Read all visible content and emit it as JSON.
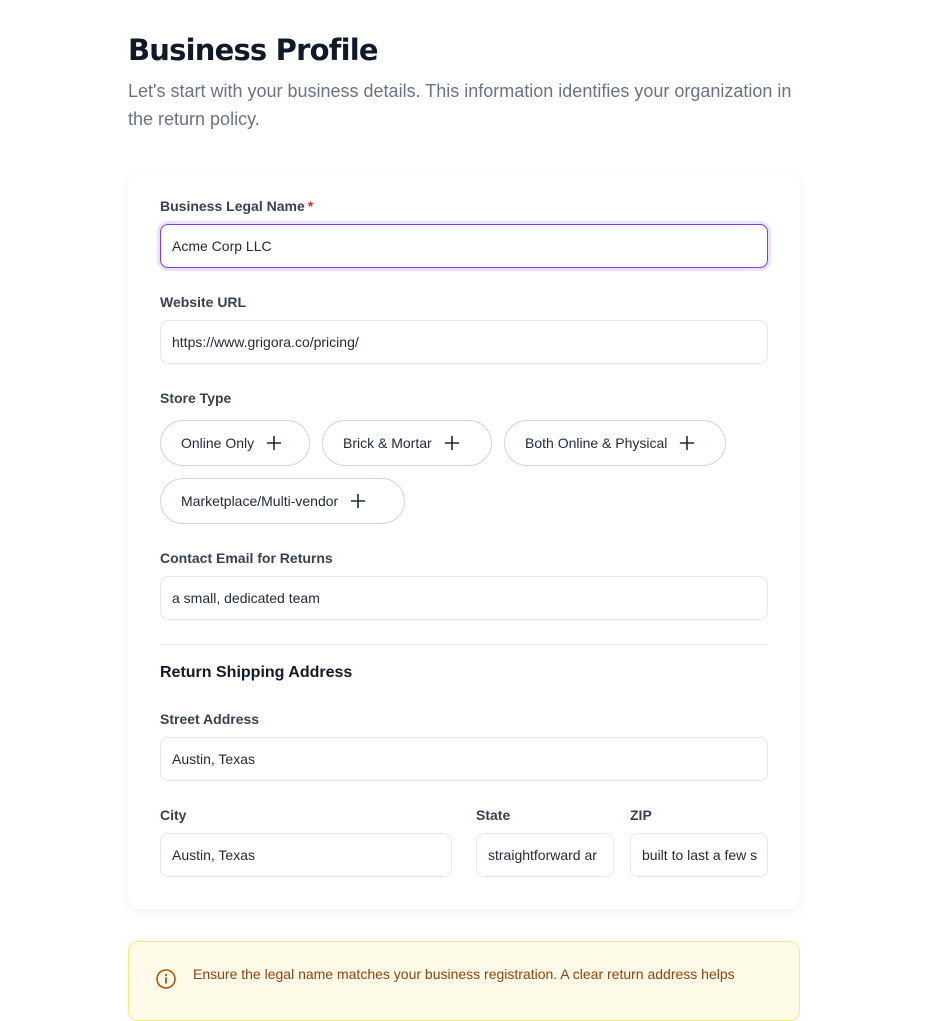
{
  "header": {
    "title": "Business Profile",
    "subtitle": "Let's start with your business details. This information identifies your organization in the return policy."
  },
  "form": {
    "legal_name": {
      "label": "Business Legal Name",
      "required_mark": "*",
      "value": "Acme Corp LLC"
    },
    "website": {
      "label": "Website URL",
      "value": "https://www.grigora.co/pricing/"
    },
    "store_type": {
      "label": "Store Type",
      "options": [
        "Online Only",
        "Brick & Mortar",
        "Both Online & Physical",
        "Marketplace/Multi-vendor"
      ]
    },
    "contact_email": {
      "label": "Contact Email for Returns",
      "value": "a small, dedicated team"
    },
    "address_section": {
      "title": "Return Shipping Address",
      "street": {
        "label": "Street Address",
        "value": "Austin, Texas"
      },
      "city": {
        "label": "City",
        "value": "Austin, Texas"
      },
      "state": {
        "label": "State",
        "value": "straightforward ar"
      },
      "zip": {
        "label": "ZIP",
        "value": "built to last a few s"
      }
    }
  },
  "notice": {
    "text": "Ensure the legal name matches your business registration. A clear return address helps"
  },
  "colors": {
    "accent": "#7c3aed",
    "required": "#dc2626",
    "notice_bg": "#fefce8",
    "notice_text": "#92400e"
  },
  "icons": {
    "chip_add": "plus-icon",
    "notice": "info-icon"
  }
}
